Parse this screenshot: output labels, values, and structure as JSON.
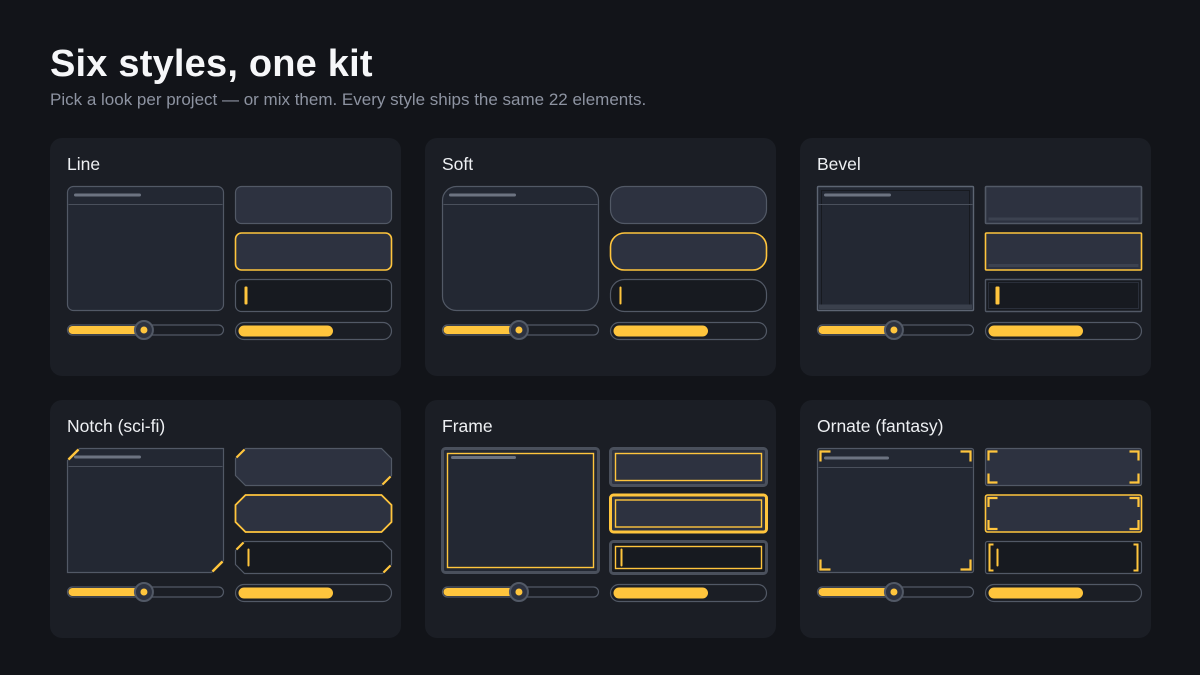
{
  "header": {
    "title": "Six styles, one kit",
    "subtitle": "Pick a look per project — or mix them. Every style ships the same 22 elements."
  },
  "colors": {
    "background": "#121419",
    "card": "#1b1e25",
    "panel": "#232833",
    "button": "#2d3240",
    "input": "#171a20",
    "outline": "#525966",
    "accent": "#ffc53d",
    "track": "#1b1e25"
  },
  "styles": [
    {
      "name": "Line",
      "key": "line"
    },
    {
      "name": "Soft",
      "key": "soft"
    },
    {
      "name": "Bevel",
      "key": "bevel"
    },
    {
      "name": "Notch (sci-fi)",
      "key": "notch"
    },
    {
      "name": "Frame",
      "key": "frame"
    },
    {
      "name": "Ornate (fantasy)",
      "key": "ornate"
    }
  ],
  "slider_value": 0.49,
  "progress_value": 0.63
}
